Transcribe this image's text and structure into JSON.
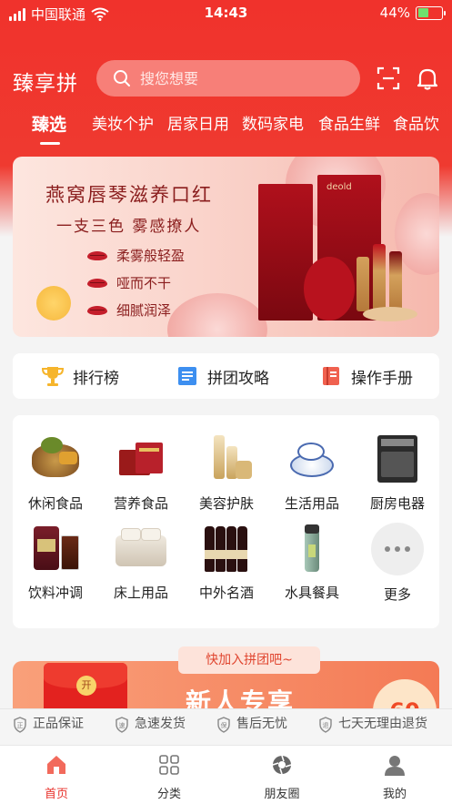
{
  "status_bar": {
    "carrier": "中国联通",
    "time": "14:43",
    "battery": "44%",
    "battery_level": 0.44
  },
  "header": {
    "brand": "臻享拼",
    "search_placeholder": "搜您想要",
    "icons": [
      "scan-icon",
      "bell-icon"
    ]
  },
  "tabs": [
    {
      "label": "臻选",
      "active": true
    },
    {
      "label": "美妆个护",
      "active": false
    },
    {
      "label": "居家日用",
      "active": false
    },
    {
      "label": "数码家电",
      "active": false
    },
    {
      "label": "食品生鲜",
      "active": false
    },
    {
      "label": "食品饮",
      "active": false
    }
  ],
  "banner": {
    "title": "燕窝唇琴滋养口红",
    "subtitle": "一支三色 雾感撩人",
    "features": [
      "柔雾般轻盈",
      "哑而不干",
      "细腻润泽"
    ],
    "brand_mark": "deold"
  },
  "quick_links": [
    {
      "label": "排行榜",
      "icon": "trophy-icon"
    },
    {
      "label": "拼团攻略",
      "icon": "guide-book-icon"
    },
    {
      "label": "操作手册",
      "icon": "manual-icon"
    }
  ],
  "categories": [
    {
      "label": "休闲食品",
      "icon": "snacks-icon"
    },
    {
      "label": "营养食品",
      "icon": "nutrition-icon"
    },
    {
      "label": "美容护肤",
      "icon": "skincare-icon"
    },
    {
      "label": "生活用品",
      "icon": "tableware-icon"
    },
    {
      "label": "厨房电器",
      "icon": "oven-icon"
    },
    {
      "label": "饮料冲调",
      "icon": "drinks-icon"
    },
    {
      "label": "床上用品",
      "icon": "bedding-icon"
    },
    {
      "label": "中外名酒",
      "icon": "wine-icon"
    },
    {
      "label": "水具餐具",
      "icon": "bottle-icon"
    },
    {
      "label": "更多",
      "icon": "more-icon"
    }
  ],
  "promo": {
    "tag": "快加入拼团吧~",
    "title": "新人专享",
    "envelope_char": "开",
    "badge": "60"
  },
  "guarantees": [
    "正品保证",
    "急速发货",
    "售后无忧",
    "七天无理由退货"
  ],
  "bottom_nav": [
    {
      "label": "首页",
      "active": true
    },
    {
      "label": "分类",
      "active": false
    },
    {
      "label": "朋友圈",
      "active": false
    },
    {
      "label": "我的",
      "active": false
    }
  ],
  "colors": {
    "brand_red": "#e8322c",
    "header_red": "#f0322c"
  }
}
